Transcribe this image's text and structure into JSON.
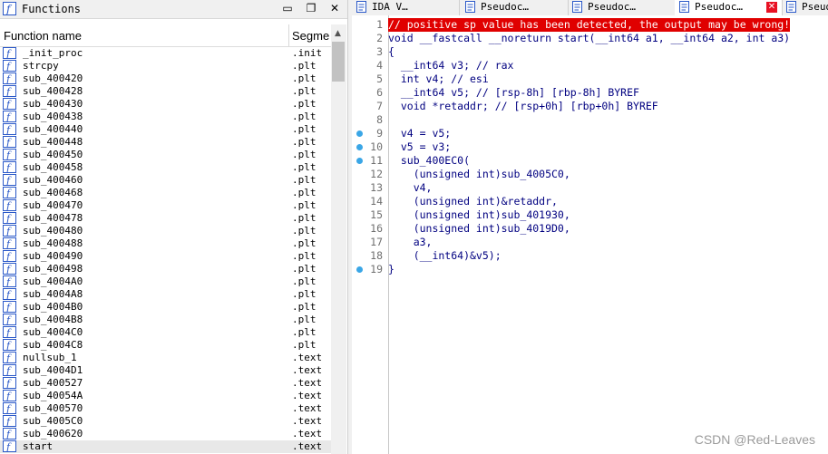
{
  "functions_panel": {
    "title": "Functions",
    "col_name": "Function name",
    "col_segment": "Segme",
    "rows": [
      {
        "name": "_init_proc",
        "segment": ".init"
      },
      {
        "name": "strcpy",
        "segment": ".plt"
      },
      {
        "name": "sub_400420",
        "segment": ".plt"
      },
      {
        "name": "sub_400428",
        "segment": ".plt"
      },
      {
        "name": "sub_400430",
        "segment": ".plt"
      },
      {
        "name": "sub_400438",
        "segment": ".plt"
      },
      {
        "name": "sub_400440",
        "segment": ".plt"
      },
      {
        "name": "sub_400448",
        "segment": ".plt"
      },
      {
        "name": "sub_400450",
        "segment": ".plt"
      },
      {
        "name": "sub_400458",
        "segment": ".plt"
      },
      {
        "name": "sub_400460",
        "segment": ".plt"
      },
      {
        "name": "sub_400468",
        "segment": ".plt"
      },
      {
        "name": "sub_400470",
        "segment": ".plt"
      },
      {
        "name": "sub_400478",
        "segment": ".plt"
      },
      {
        "name": "sub_400480",
        "segment": ".plt"
      },
      {
        "name": "sub_400488",
        "segment": ".plt"
      },
      {
        "name": "sub_400490",
        "segment": ".plt"
      },
      {
        "name": "sub_400498",
        "segment": ".plt"
      },
      {
        "name": "sub_4004A0",
        "segment": ".plt"
      },
      {
        "name": "sub_4004A8",
        "segment": ".plt"
      },
      {
        "name": "sub_4004B0",
        "segment": ".plt"
      },
      {
        "name": "sub_4004B8",
        "segment": ".plt"
      },
      {
        "name": "sub_4004C0",
        "segment": ".plt"
      },
      {
        "name": "sub_4004C8",
        "segment": ".plt"
      },
      {
        "name": "nullsub_1",
        "segment": ".text"
      },
      {
        "name": "sub_4004D1",
        "segment": ".text"
      },
      {
        "name": "sub_400527",
        "segment": ".text"
      },
      {
        "name": "sub_40054A",
        "segment": ".text"
      },
      {
        "name": "sub_400570",
        "segment": ".text"
      },
      {
        "name": "sub_4005C0",
        "segment": ".text"
      },
      {
        "name": "sub_400620",
        "segment": ".text"
      },
      {
        "name": "start",
        "segment": ".text"
      }
    ]
  },
  "tabs": [
    {
      "label": "IDA V…",
      "active": false,
      "closable": false
    },
    {
      "label": "Pseudoc…",
      "active": false,
      "closable": false
    },
    {
      "label": "Pseudoc…",
      "active": false,
      "closable": false
    },
    {
      "label": "Pseudoc…",
      "active": true,
      "closable": true
    },
    {
      "label": "Pseud",
      "active": false,
      "closable": false
    }
  ],
  "code": {
    "warning": "// positive sp value has been detected, the output may be wrong!",
    "lines": [
      {
        "n": "1"
      },
      {
        "n": "2",
        "text": "void __fastcall __noreturn start(__int64 a1, __int64 a2, int a3)"
      },
      {
        "n": "3",
        "text": "{"
      },
      {
        "n": "4",
        "text": "  __int64 v3; // rax"
      },
      {
        "n": "5",
        "text": "  int v4; // esi"
      },
      {
        "n": "6",
        "text": "  __int64 v5; // [rsp-8h] [rbp-8h] BYREF"
      },
      {
        "n": "7",
        "text": "  void *retaddr; // [rsp+0h] [rbp+0h] BYREF"
      },
      {
        "n": "8",
        "text": ""
      },
      {
        "n": "9",
        "text": "  v4 = v5;"
      },
      {
        "n": "10",
        "text": "  v5 = v3;"
      },
      {
        "n": "11",
        "text": "  sub_400EC0("
      },
      {
        "n": "12",
        "text": "    (unsigned int)sub_4005C0,"
      },
      {
        "n": "13",
        "text": "    v4,"
      },
      {
        "n": "14",
        "text": "    (unsigned int)&retaddr,"
      },
      {
        "n": "15",
        "text": "    (unsigned int)sub_401930,"
      },
      {
        "n": "16",
        "text": "    (unsigned int)sub_4019D0,"
      },
      {
        "n": "17",
        "text": "    a3,"
      },
      {
        "n": "18",
        "text": "    (__int64)&v5);"
      },
      {
        "n": "19",
        "text": "}"
      }
    ],
    "breakpoint_lines": [
      "9",
      "10",
      "11",
      "19"
    ]
  },
  "watermark": "CSDN @Red-Leaves",
  "colors": {
    "warning_bg": "#e00000",
    "breakpoint": "#3aa6e6",
    "keyword": "#000080"
  }
}
